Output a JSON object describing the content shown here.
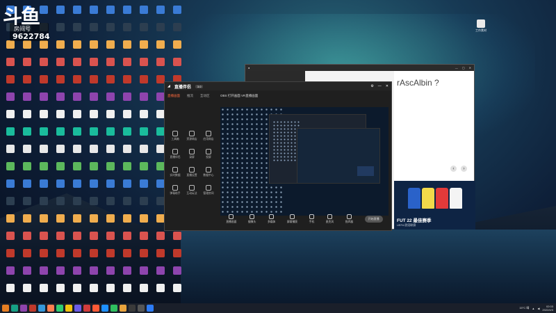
{
  "overlay": {
    "logo": "斗鱼",
    "room_label": "房间号",
    "room_number": "9622784"
  },
  "obs": {
    "brand": "直播伴侣",
    "badge": "3.0",
    "tabs": [
      "直播画面",
      "推流",
      "互动区"
    ],
    "header": "OBS 打开画面 VR直播画面",
    "tools": [
      "工具箱",
      "资源商店",
      "应用商店",
      "直播伴侣",
      "录屏",
      "投屏",
      "实时数据",
      "直播设置",
      "数据中心",
      "弹幕助手",
      "互动玩法",
      "管理房间"
    ],
    "bottom_buttons": [
      "直播画面",
      "摄像头",
      "多媒体",
      "屏幕捕获",
      "手机",
      "麦克风",
      "扬声器"
    ],
    "start_label": "开始直播"
  },
  "browser": {
    "heading": "rAscAlbin ?",
    "card_title": "FUT 22 最佳赛季",
    "card_sub": "UEFA 欧冠联赛"
  },
  "right_icon_label": "工作素材",
  "clock": {
    "time": "02:03",
    "date": "2022/4/3"
  },
  "tray_temp": "15°C 晴",
  "colors": {
    "accent": "#ff6a3d",
    "desktop_sky": "#173a55",
    "taskbar": "#1a1f2a"
  }
}
